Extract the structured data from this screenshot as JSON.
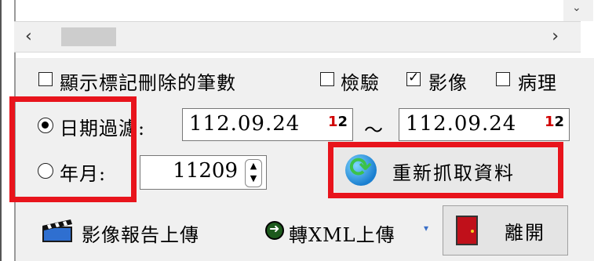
{
  "list": {
    "scroll_left": "‹",
    "scroll_right": "›",
    "scroll_down": "⌄"
  },
  "filters": {
    "show_deleted_count": {
      "label": "顯示標記刪除的筆數",
      "checked": false
    },
    "inspection": {
      "label": "檢驗",
      "checked": false
    },
    "imaging": {
      "label": "影像",
      "checked": true
    },
    "pathology": {
      "label": "病理",
      "checked": false
    }
  },
  "date_filter": {
    "radio_label": "日期過濾:",
    "selected": true,
    "start_date": "112.09.24",
    "end_date": "112.09.24",
    "separator": "～",
    "picker_glyph_a": "1",
    "picker_glyph_b": "2"
  },
  "month_filter": {
    "radio_label": "年月:",
    "selected": false,
    "value": "11209",
    "spin_up": "▲",
    "spin_down": "▼"
  },
  "buttons": {
    "refresh": "重新抓取資料",
    "upload_report": "影像報告上傳",
    "to_xml_upload": "轉XML上傳",
    "dropdown_arrow": "▾",
    "exit": "離開"
  },
  "colors": {
    "highlight_red": "#e8141c",
    "panel_bg": "#f0f0f0"
  }
}
